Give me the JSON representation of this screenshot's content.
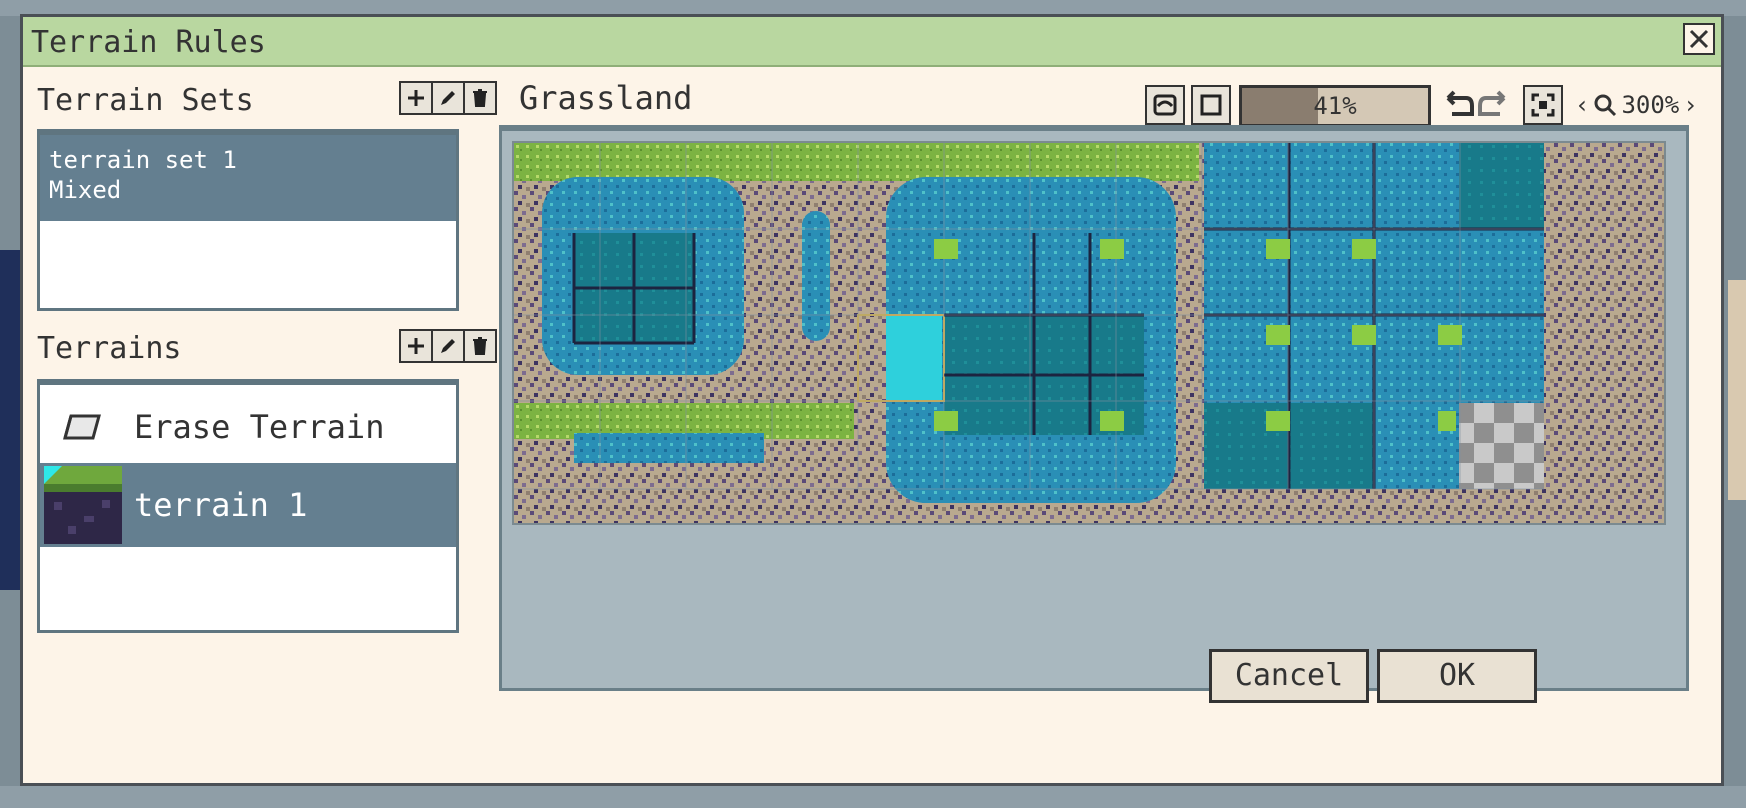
{
  "dialog": {
    "title": "Terrain Rules"
  },
  "terrain_sets": {
    "label": "Terrain Sets",
    "items": [
      {
        "name": "terrain set 1",
        "mode": "Mixed"
      }
    ]
  },
  "terrains": {
    "label": "Terrains",
    "items": [
      {
        "label": "Erase Terrain"
      },
      {
        "label": "terrain 1"
      }
    ]
  },
  "tileset": {
    "name": "Grassland",
    "opacity": "41%",
    "opacity_value": 0.41,
    "zoom": "300%"
  },
  "buttons": {
    "cancel": "Cancel",
    "ok": "OK"
  },
  "icons": {
    "add": "plus-icon",
    "edit": "pencil-icon",
    "delete": "trash-icon"
  }
}
